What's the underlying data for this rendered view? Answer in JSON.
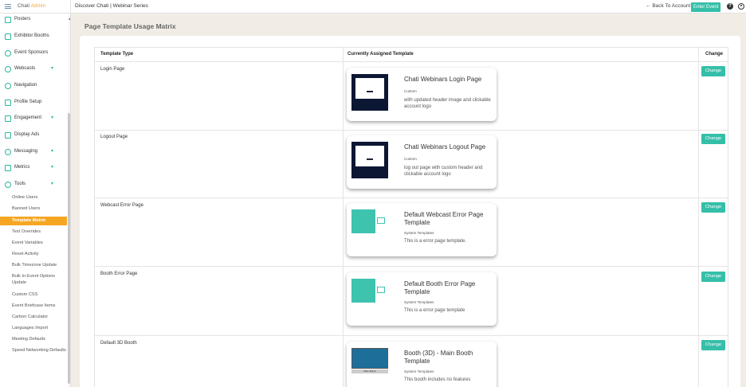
{
  "topbar": {
    "brand_prefix": "Chati",
    "brand_accent": "Admin",
    "breadcrumb": "Discover Chati | Webinar Series",
    "back_label": "Back To Account",
    "enter_label": "Enter Event",
    "help_glyph": "?"
  },
  "sidebar": {
    "items": [
      {
        "label": "Posters",
        "icon": "poster-icon"
      },
      {
        "label": "Exhibitor Booths",
        "icon": "booth-icon"
      },
      {
        "label": "Event Sponsors",
        "icon": "sponsors-icon"
      },
      {
        "label": "Webcasts",
        "icon": "webcast-icon"
      },
      {
        "label": "Navigation",
        "icon": "navigation-icon"
      },
      {
        "label": "Profile Setup",
        "icon": "profile-icon"
      },
      {
        "label": "Engagement",
        "icon": "engagement-icon"
      },
      {
        "label": "Display Ads",
        "icon": "ads-icon"
      },
      {
        "label": "Messaging",
        "icon": "messaging-icon"
      },
      {
        "label": "Metrics",
        "icon": "metrics-icon"
      },
      {
        "label": "Tools",
        "icon": "tools-icon"
      }
    ],
    "sub_items": [
      "Online Users",
      "Banned Users",
      "Template Matrix",
      "Text Overrides",
      "Event Variables",
      "Reset Activity",
      "Bulk Timezone Update",
      "Bulk In-Event Options Update",
      "Custom CSS",
      "Event Briefcase Items",
      "Carbon Calculator",
      "Languages Import",
      "Meeting Defaults",
      "Speed Networking Defaults"
    ],
    "active_sub": "Template Matrix"
  },
  "main": {
    "title": "Page Template Usage Matrix",
    "columns": [
      "Template Type",
      "Currently Assigned Template",
      "Change"
    ],
    "change_label": "Change",
    "rows": [
      {
        "type": "Login Page",
        "template": "Chati Webinars Login Page",
        "category": "Custom",
        "desc": "with updated header image and clickable account logo",
        "thumb": "dark"
      },
      {
        "type": "Logout Page",
        "template": "Chati Webinars Logout Page",
        "category": "Custom",
        "desc": "log out page with custom header and clickable account logo",
        "thumb": "dark"
      },
      {
        "type": "Webcast Error Page",
        "template": "Default Webcast Error Page Template",
        "category": "System Templates",
        "desc": "This is a error page template.",
        "thumb": "teal"
      },
      {
        "type": "Booth Error Page",
        "template": "Default Booth Error Page Template",
        "category": "System Templates",
        "desc": "This is a error page template",
        "thumb": "teal"
      },
      {
        "type": "Default 3D Booth",
        "template": "Booth (3D) - Main Booth Template",
        "category": "System Templates",
        "desc": "This booth includes no features",
        "thumb": "booth",
        "thumb_caption": "Main Booth"
      }
    ]
  },
  "colors": {
    "accent": "#35bfa9",
    "active": "#f5a623",
    "background": "#f1ede6"
  }
}
